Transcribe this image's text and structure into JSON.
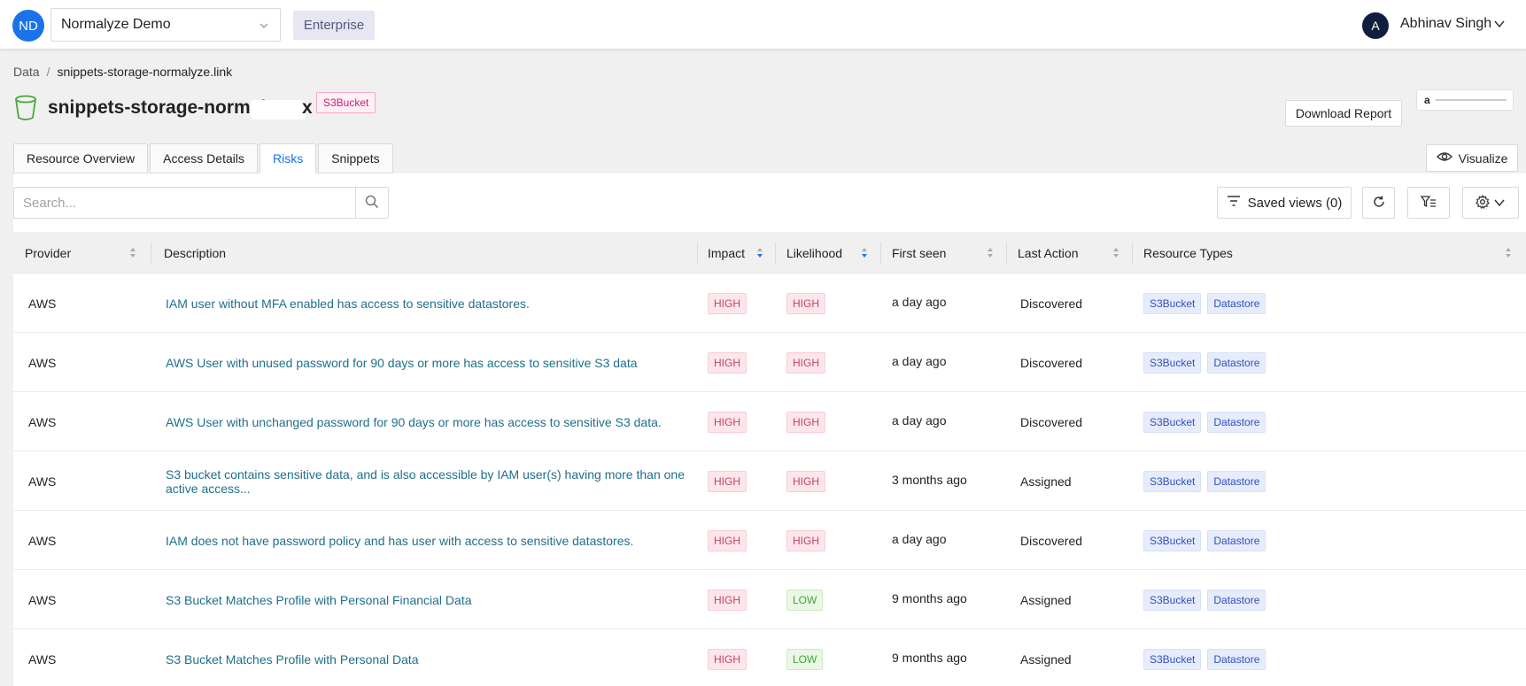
{
  "org": {
    "avatar": "ND",
    "name": "Normalyze Demo",
    "plan": "Enterprise"
  },
  "user": {
    "avatar": "A",
    "name": "Abhinav Singh"
  },
  "breadcrumb": {
    "root": "Data",
    "separator": "/",
    "current": "snippets-storage-normalyze.link"
  },
  "resource": {
    "title": "snippets-storage-normaly",
    "title_suffix": "x",
    "type_badge": "S3Bucket",
    "provider_logo": "a",
    "bucket_icon": "bucket-icon"
  },
  "actions": {
    "download": "Download Report",
    "visualize": "Visualize"
  },
  "tabs": [
    {
      "label": "Resource Overview"
    },
    {
      "label": "Access Details"
    },
    {
      "label": "Risks"
    },
    {
      "label": "Snippets"
    }
  ],
  "active_tab": "Risks",
  "toolbar": {
    "search_placeholder": "Search...",
    "saved_views": "Saved views (0)"
  },
  "columns": {
    "provider": "Provider",
    "description": "Description",
    "impact": "Impact",
    "likelihood": "Likelihood",
    "first_seen": "First seen",
    "last_action": "Last Action",
    "resource_types": "Resource Types"
  },
  "rows": [
    {
      "provider": "AWS",
      "description": "IAM user without MFA enabled has access to sensitive datastores.",
      "impact": "HIGH",
      "likelihood": "HIGH",
      "first_seen": "a day ago",
      "last_action": "Discovered",
      "types": [
        "S3Bucket",
        "Datastore"
      ]
    },
    {
      "provider": "AWS",
      "description": "AWS User with unused password for 90 days or more has access to sensitive S3 data",
      "impact": "HIGH",
      "likelihood": "HIGH",
      "first_seen": "a day ago",
      "last_action": "Discovered",
      "types": [
        "S3Bucket",
        "Datastore"
      ]
    },
    {
      "provider": "AWS",
      "description": "AWS User with unchanged password for 90 days or more has access to sensitive S3 data.",
      "impact": "HIGH",
      "likelihood": "HIGH",
      "first_seen": "a day ago",
      "last_action": "Discovered",
      "types": [
        "S3Bucket",
        "Datastore"
      ]
    },
    {
      "provider": "AWS",
      "description": "S3 bucket contains sensitive data, and is also accessible by IAM user(s) having more than one active access...",
      "impact": "HIGH",
      "likelihood": "HIGH",
      "first_seen": "3 months ago",
      "last_action": "Assigned",
      "types": [
        "S3Bucket",
        "Datastore"
      ]
    },
    {
      "provider": "AWS",
      "description": "IAM does not have password policy and has user with access to sensitive datastores.",
      "impact": "HIGH",
      "likelihood": "HIGH",
      "first_seen": "a day ago",
      "last_action": "Discovered",
      "types": [
        "S3Bucket",
        "Datastore"
      ]
    },
    {
      "provider": "AWS",
      "description": "S3 Bucket Matches Profile with Personal Financial Data",
      "impact": "HIGH",
      "likelihood": "LOW",
      "first_seen": "9 months ago",
      "last_action": "Assigned",
      "types": [
        "S3Bucket",
        "Datastore"
      ]
    },
    {
      "provider": "AWS",
      "description": "S3 Bucket Matches Profile with Personal Data",
      "impact": "HIGH",
      "likelihood": "LOW",
      "first_seen": "9 months ago",
      "last_action": "Assigned",
      "types": [
        "S3Bucket",
        "Datastore"
      ]
    }
  ],
  "colors": {
    "accent": "#1a73e8",
    "link": "#1f6f8b",
    "high": "#c0446a",
    "low": "#3fa63c",
    "resource_tag": "#3050c0"
  }
}
